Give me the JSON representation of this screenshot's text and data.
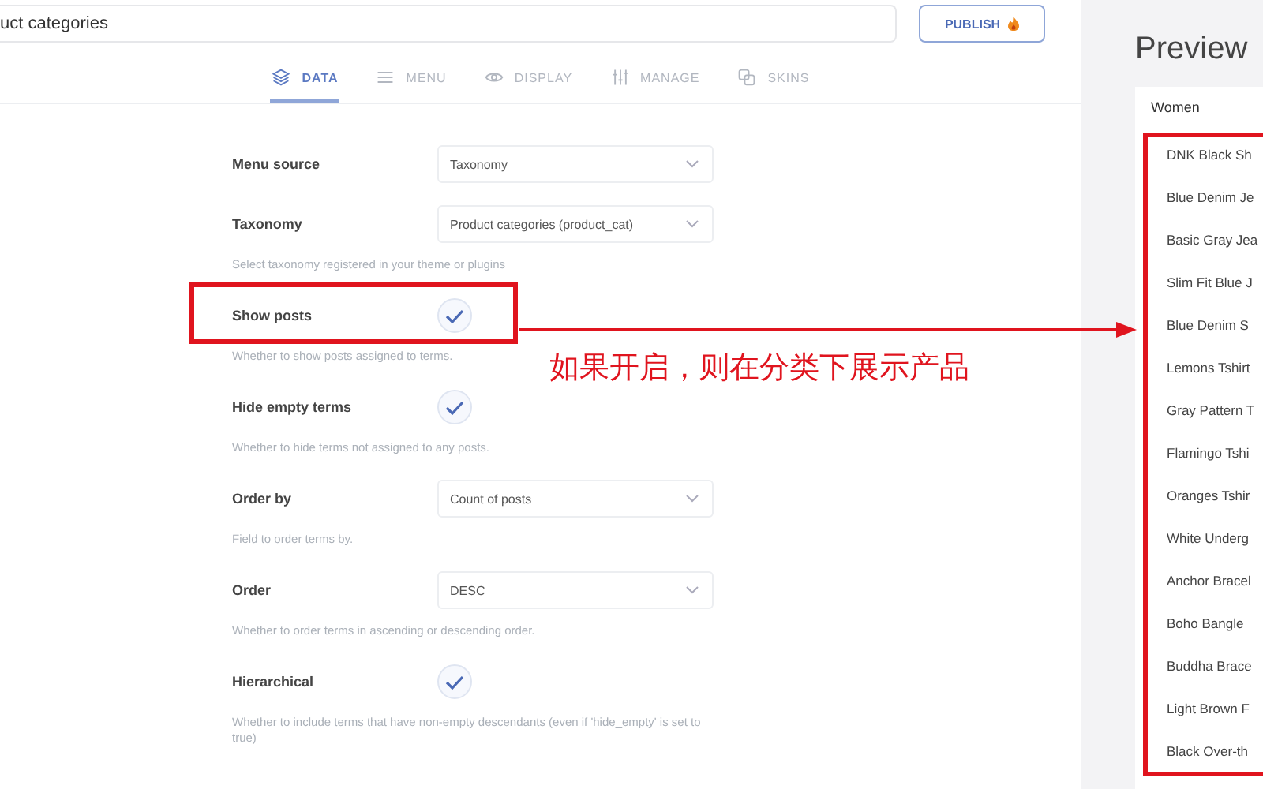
{
  "title_field": {
    "value": "uct categories"
  },
  "publish_button": {
    "label": "PUBLISH"
  },
  "tabs": [
    {
      "label": "DATA",
      "selected": true
    },
    {
      "label": "MENU",
      "selected": false
    },
    {
      "label": "DISPLAY",
      "selected": false
    },
    {
      "label": "MANAGE",
      "selected": false
    },
    {
      "label": "SKINS",
      "selected": false
    }
  ],
  "settings": [
    {
      "kind": "select",
      "label": "Menu source",
      "value": "Taxonomy"
    },
    {
      "kind": "select",
      "label": "Taxonomy",
      "value": "Product categories (product_cat)",
      "help": "Select taxonomy registered in your theme or plugins"
    },
    {
      "kind": "checkbox",
      "label": "Show posts",
      "checked": true,
      "help": "Whether to show posts assigned to terms.",
      "highlighted": true
    },
    {
      "kind": "checkbox",
      "label": "Hide empty terms",
      "checked": true,
      "help": "Whether to hide terms not assigned to any posts."
    },
    {
      "kind": "select",
      "label": "Order by",
      "value": "Count of posts",
      "help": "Field to order terms by."
    },
    {
      "kind": "select",
      "label": "Order",
      "value": "DESC",
      "help": "Whether to order terms in ascending or descending order."
    },
    {
      "kind": "checkbox",
      "label": "Hierarchical",
      "checked": true,
      "help": "Whether to include terms that have non-empty descendants (even if 'hide_empty' is set to true)"
    }
  ],
  "annotation": {
    "text": "如果开启，则在分类下展示产品"
  },
  "preview": {
    "title": "Preview",
    "category": "Women",
    "items": [
      "DNK Black Sh",
      "Blue Denim Je",
      "Basic Gray Jea",
      "Slim Fit Blue J",
      "Blue Denim S",
      "Lemons Tshirt",
      "Gray Pattern T",
      "Flamingo Tshi",
      "Oranges Tshir",
      "White Underg",
      "Anchor Bracel",
      "Boho Bangle",
      "Buddha Brace",
      "Light Brown F",
      "Black Over-th"
    ]
  }
}
